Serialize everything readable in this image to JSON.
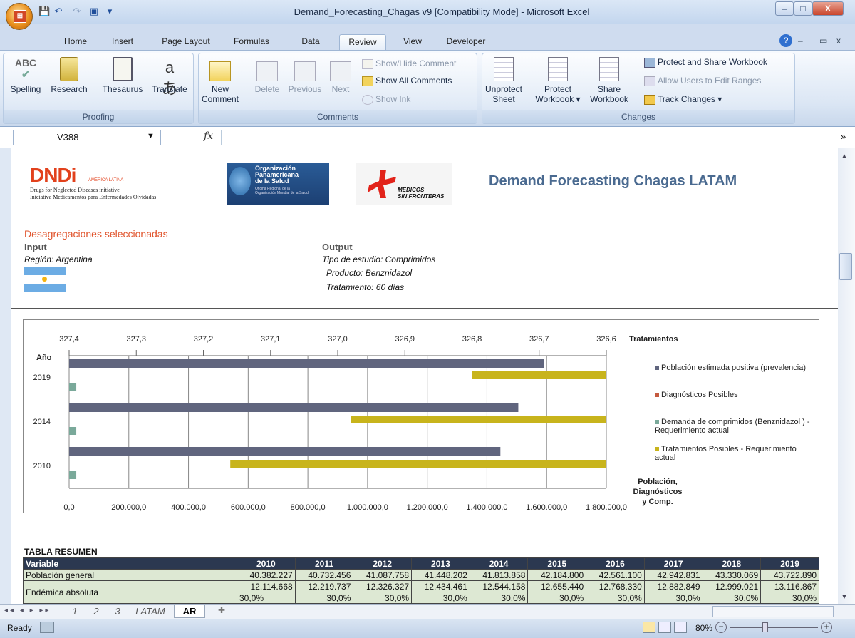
{
  "window": {
    "title": "Demand_Forecasting_Chagas v9  [Compatibility Mode] - Microsoft Excel",
    "office_label": "Office",
    "min": "–",
    "max": "□",
    "close": "X"
  },
  "ribbon_tabs": [
    "Home",
    "Insert",
    "Page Layout",
    "Formulas",
    "Data",
    "Review",
    "View",
    "Developer"
  ],
  "active_tab": "Review",
  "ribbon": {
    "proofing": {
      "label": "Proofing",
      "spelling": "Spelling",
      "research": "Research",
      "thesaurus": "Thesaurus",
      "translate": "Translate"
    },
    "comments": {
      "label": "Comments",
      "new_comment_1": "New",
      "new_comment_2": "Comment",
      "delete": "Delete",
      "previous": "Previous",
      "next": "Next",
      "show_hide": "Show/Hide Comment",
      "show_all": "Show All Comments",
      "show_ink": "Show Ink"
    },
    "changes": {
      "label": "Changes",
      "unprotect_1": "Unprotect",
      "unprotect_2": "Sheet",
      "protect_1": "Protect",
      "protect_2": "Workbook ▾",
      "share_1": "Share",
      "share_2": "Workbook",
      "protect_share": "Protect and Share Workbook",
      "allow_edit": "Allow Users to Edit Ranges",
      "track_changes": "Track Changes ▾"
    },
    "help": "?"
  },
  "formula_bar": {
    "name_box": "V388",
    "fx": "fx",
    "value": ""
  },
  "header": {
    "dndi_main": "DNDi",
    "dndi_sub": "AMÉRICA LATINA",
    "dndi_line1": "Drugs for Neglected Diseases initiative",
    "dndi_line2": "Iniciativa Medicamentos para Enfermedades Olvidadas",
    "ops_line1": "Organización",
    "ops_line2": "Panamericana",
    "ops_line3": "de la Salud",
    "ops_small1": "Oficina Regional de la",
    "ops_small2": "Organización Mundial de la Salud",
    "msf_line1": "MEDICOS",
    "msf_line2": "SIN FRONTERAS",
    "title": "Demand Forecasting Chagas LATAM"
  },
  "selection": {
    "heading": "Desagregaciones seleccionadas",
    "input_label": "Input",
    "region": "Región: Argentina",
    "output_label": "Output",
    "study": "Tipo de estudio: Comprimidos",
    "product": "Producto: Benznidazol",
    "treatment": "Tratamiento: 60 días"
  },
  "chart_data": {
    "type": "bar",
    "orientation": "horizontal",
    "categories": [
      "2019",
      "2014",
      "2010"
    ],
    "ylabel": "Año",
    "xlabel": "Población, Diagnósticos y Comp.",
    "x2label": "Tratamientos",
    "xlim": [
      0,
      1800000
    ],
    "x_ticks": [
      "0,0",
      "200.000,0",
      "400.000,0",
      "600.000,0",
      "800.000,0",
      "1.000.000,0",
      "1.200.000,0",
      "1.400.000,0",
      "1.600.000,0",
      "1.800.000,0"
    ],
    "x2lim": [
      327.4,
      326.6
    ],
    "x2_ticks": [
      "327,4",
      "327,3",
      "327,2",
      "327,1",
      "327,0",
      "326,9",
      "326,8",
      "326,7",
      "326,6"
    ],
    "grid": true,
    "legend_position": "right",
    "series": [
      {
        "name": "Población estimada positiva (prevalencia)",
        "color": "#60657e",
        "axis": "primary",
        "values": [
          1590000,
          1505000,
          1445000
        ]
      },
      {
        "name": "Diagnósticos Posibles",
        "color": "#c55a3f",
        "axis": "primary",
        "values": [
          0,
          0,
          0
        ]
      },
      {
        "name": "Demanda de comprimidos (Benznidazol ) - Requerimiento actual",
        "color": "#7aa99a",
        "axis": "primary",
        "values": [
          24000,
          24000,
          24000
        ]
      },
      {
        "name": "Tratamientos Posibles - Requerimiento actual",
        "color": "#c8b41c",
        "axis": "secondary",
        "values": [
          326.8,
          326.98,
          327.16
        ]
      }
    ]
  },
  "table": {
    "title": "TABLA RESUMEN",
    "header": [
      "Variable",
      "2010",
      "2011",
      "2012",
      "2013",
      "2014",
      "2015",
      "2016",
      "2017",
      "2018",
      "2019"
    ],
    "rows": [
      [
        "Población general",
        "40.382.227",
        "40.732.456",
        "41.087.758",
        "41.448.202",
        "41.813.858",
        "42.184.800",
        "42.561.100",
        "42.942.831",
        "43.330.069",
        "43.722.890"
      ],
      [
        "Endémica absoluta",
        "12.114.668",
        "12.219.737",
        "12.326.327",
        "12.434.461",
        "12.544.158",
        "12.655.440",
        "12.768.330",
        "12.882.849",
        "12.999.021",
        "13.116.867"
      ],
      [
        "",
        "30,0%",
        "30,0%",
        "30,0%",
        "30,0%",
        "30,0%",
        "30,0%",
        "30,0%",
        "30,0%",
        "30,0%",
        "30,0%"
      ]
    ]
  },
  "sheet_tabs": [
    "1",
    "2",
    "3",
    "LATAM",
    "AR"
  ],
  "active_sheet": "AR",
  "status": {
    "ready": "Ready",
    "zoom": "80%"
  }
}
